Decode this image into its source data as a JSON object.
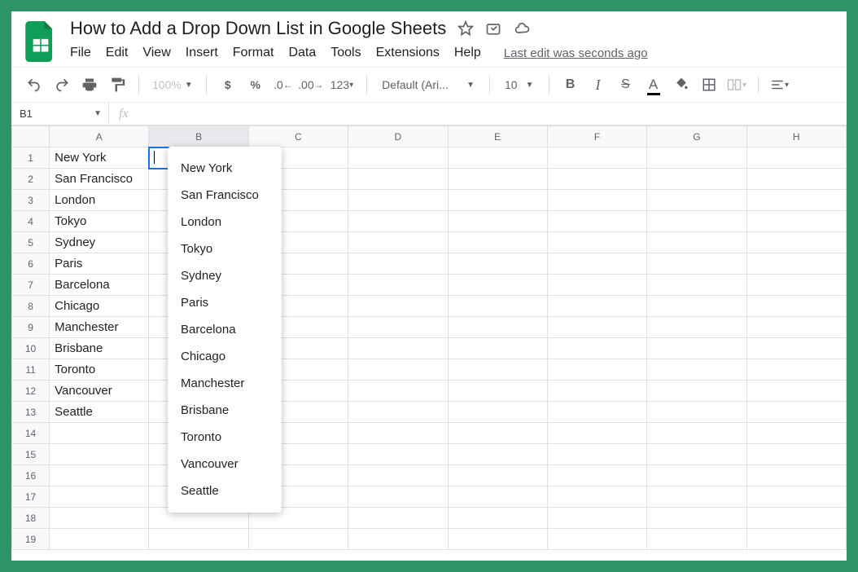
{
  "header": {
    "title": "How to Add a Drop Down List in Google Sheets",
    "last_edit": "Last edit was seconds ago",
    "menus": [
      "File",
      "Edit",
      "View",
      "Insert",
      "Format",
      "Data",
      "Tools",
      "Extensions",
      "Help"
    ]
  },
  "toolbar": {
    "zoom": "100%",
    "font": "Default (Ari...",
    "font_size": "10",
    "dollar": "$",
    "percent": "%",
    "dec_dec": ".0",
    "dec_inc": ".00",
    "num_fmt": "123",
    "bold": "B",
    "italic": "I",
    "strike": "S"
  },
  "formula_bar": {
    "cell_ref": "B1",
    "fx": "fx"
  },
  "columns": [
    "A",
    "B",
    "C",
    "D",
    "E",
    "F",
    "G",
    "H"
  ],
  "rows": [
    1,
    2,
    3,
    4,
    5,
    6,
    7,
    8,
    9,
    10,
    11,
    12,
    13,
    14,
    15,
    16,
    17,
    18,
    19
  ],
  "colA": [
    "New York",
    "San Francisco",
    "London",
    "Tokyo",
    "Sydney",
    "Paris",
    "Barcelona",
    "Chicago",
    "Manchester",
    "Brisbane",
    "Toronto",
    "Vancouver",
    "Seattle",
    "",
    "",
    "",
    "",
    "",
    ""
  ],
  "dropdown": [
    "New York",
    "San Francisco",
    "London",
    "Tokyo",
    "Sydney",
    "Paris",
    "Barcelona",
    "Chicago",
    "Manchester",
    "Brisbane",
    "Toronto",
    "Vancouver",
    "Seattle"
  ]
}
